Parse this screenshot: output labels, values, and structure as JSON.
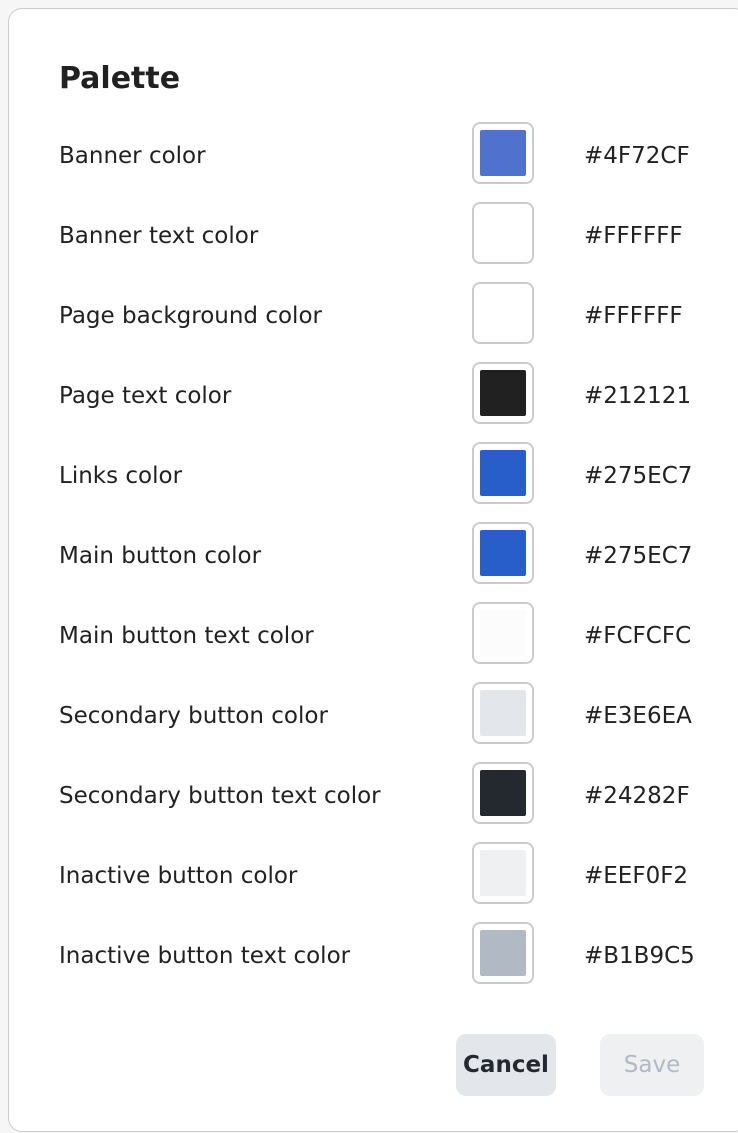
{
  "dialog": {
    "title": "Palette"
  },
  "palette": {
    "rows": [
      {
        "label": "Banner color",
        "hex": "#4F72CF",
        "color": "#4F72CF"
      },
      {
        "label": "Banner text color",
        "hex": "#FFFFFF",
        "color": "#FFFFFF"
      },
      {
        "label": "Page background color",
        "hex": "#FFFFFF",
        "color": "#FFFFFF"
      },
      {
        "label": "Page text color",
        "hex": "#212121",
        "color": "#212121"
      },
      {
        "label": "Links color",
        "hex": "#275EC7",
        "color": "#275EC7"
      },
      {
        "label": "Main button color",
        "hex": "#275EC7",
        "color": "#275EC7"
      },
      {
        "label": "Main button text color",
        "hex": "#FCFCFC",
        "color": "#FCFCFC"
      },
      {
        "label": "Secondary button color",
        "hex": "#E3E6EA",
        "color": "#E3E6EA"
      },
      {
        "label": "Secondary button text color",
        "hex": "#24282F",
        "color": "#24282F"
      },
      {
        "label": "Inactive button color",
        "hex": "#EEF0F2",
        "color": "#EEF0F2"
      },
      {
        "label": "Inactive button text color",
        "hex": "#B1B9C5",
        "color": "#B1B9C5"
      }
    ]
  },
  "actions": {
    "cancel_label": "Cancel",
    "save_label": "Save",
    "save_enabled": false
  }
}
